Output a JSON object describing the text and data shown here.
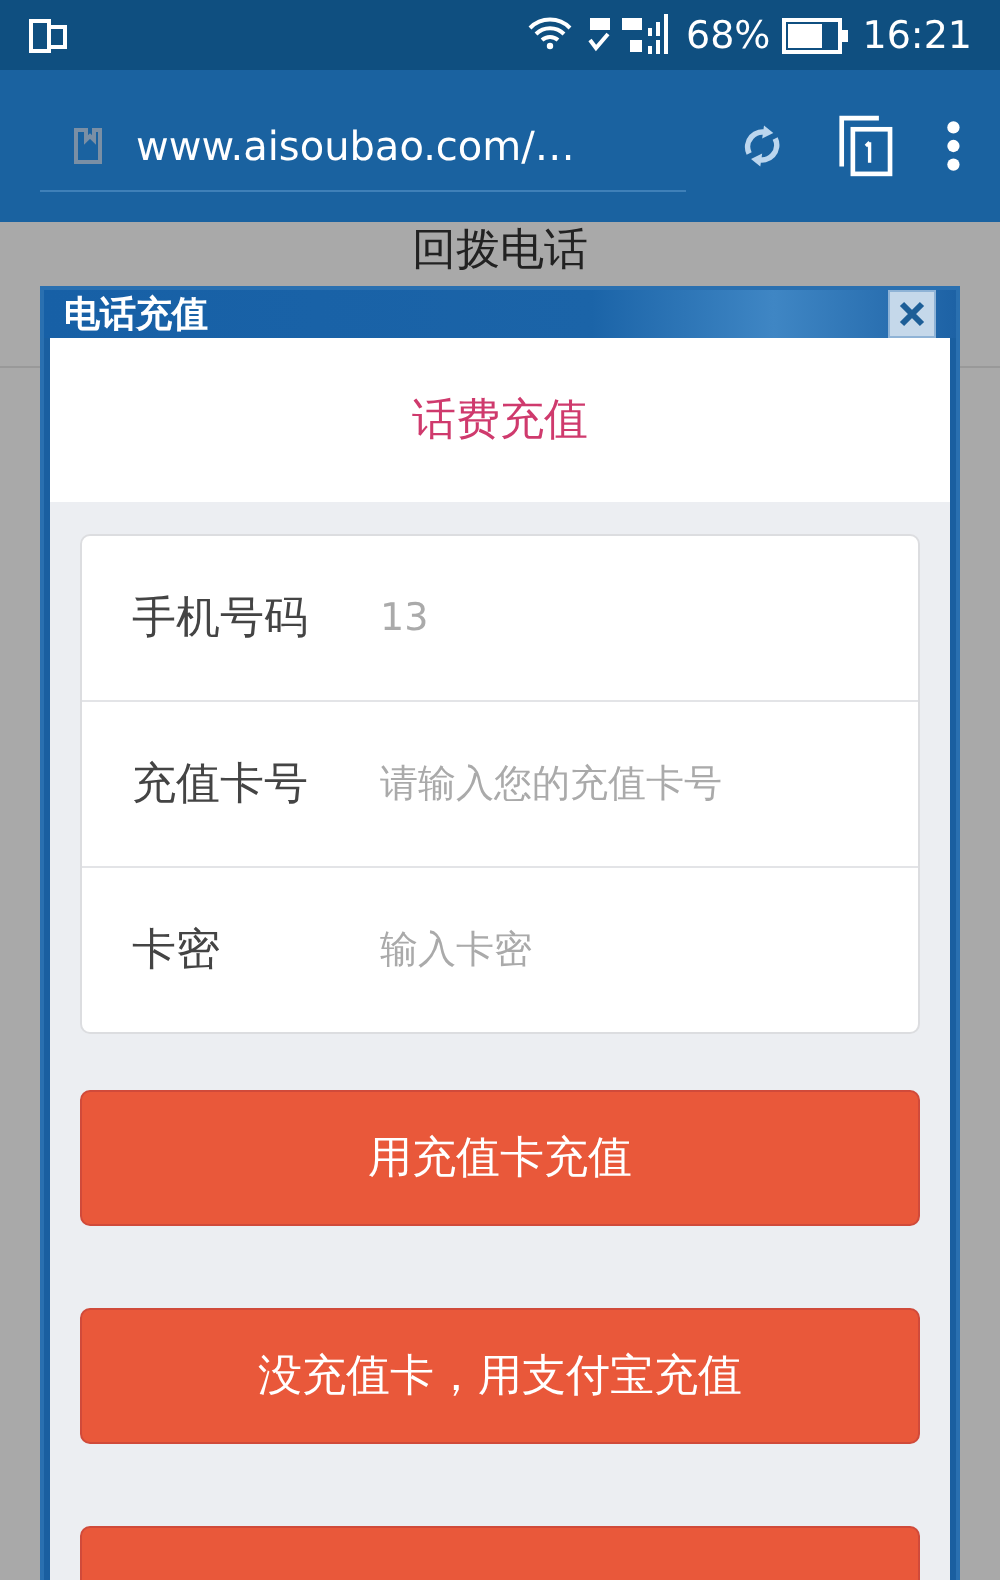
{
  "status_bar": {
    "battery": "68%",
    "time": "16:21"
  },
  "browser": {
    "url": "www.aisoubao.com/…"
  },
  "backdrop": {
    "title": "回拨电话"
  },
  "dialog": {
    "title": "电话充值",
    "heading": "话费充值",
    "fields": [
      {
        "label": "手机号码",
        "value": "13"
      },
      {
        "label": "充值卡号",
        "placeholder": "请输入您的充值卡号"
      },
      {
        "label": "卡密",
        "placeholder": "输入卡密"
      }
    ],
    "buttons": [
      {
        "label": "用充值卡充值"
      },
      {
        "label": "没充值卡，用支付宝充值"
      },
      {
        "kind": "cut-off"
      }
    ]
  }
}
